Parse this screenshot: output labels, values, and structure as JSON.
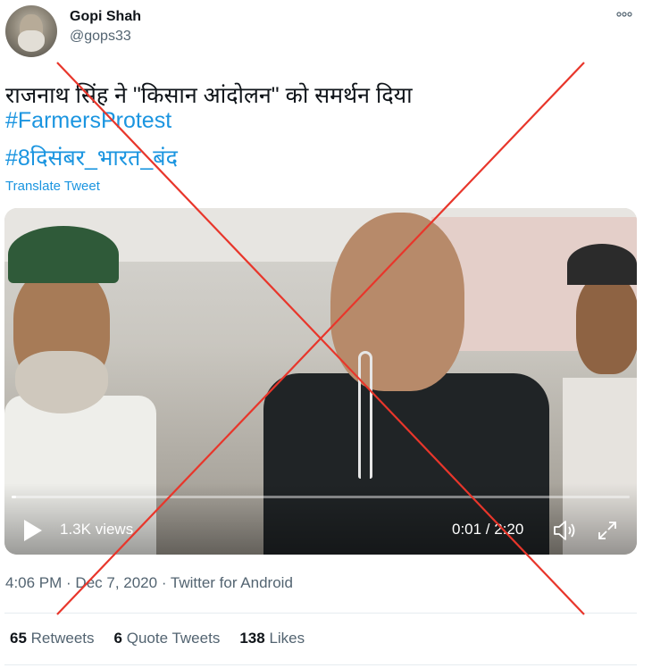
{
  "user": {
    "name": "Gopi Shah",
    "handle": "@gops33"
  },
  "more_icon": "more-horizontal-icon",
  "tweet": {
    "text": "राजनाथ सिंह ने \"किसान आंदोलन\" को समर्थन दिया",
    "hashtags": [
      "#FarmersProtest",
      "#8दिसंबर_भारत_बंद"
    ],
    "translate_label": "Translate Tweet"
  },
  "video": {
    "views": "1.3K views",
    "time": "0:01 / 2:20",
    "progress_fraction": 0.007,
    "play_icon": "play-icon",
    "volume_icon": "volume-icon",
    "fullscreen_icon": "fullscreen-icon"
  },
  "meta": {
    "line": "4:06 PM · Dec 7, 2020 · Twitter for Android"
  },
  "stats": {
    "retweets_count": "65",
    "retweets_label": "Retweets",
    "quotes_count": "6",
    "quotes_label": "Quote Tweets",
    "likes_count": "138",
    "likes_label": "Likes"
  },
  "overlay": {
    "cross_color": "#e8362b"
  },
  "colors": {
    "link": "#1b95e0",
    "muted": "#536471"
  }
}
